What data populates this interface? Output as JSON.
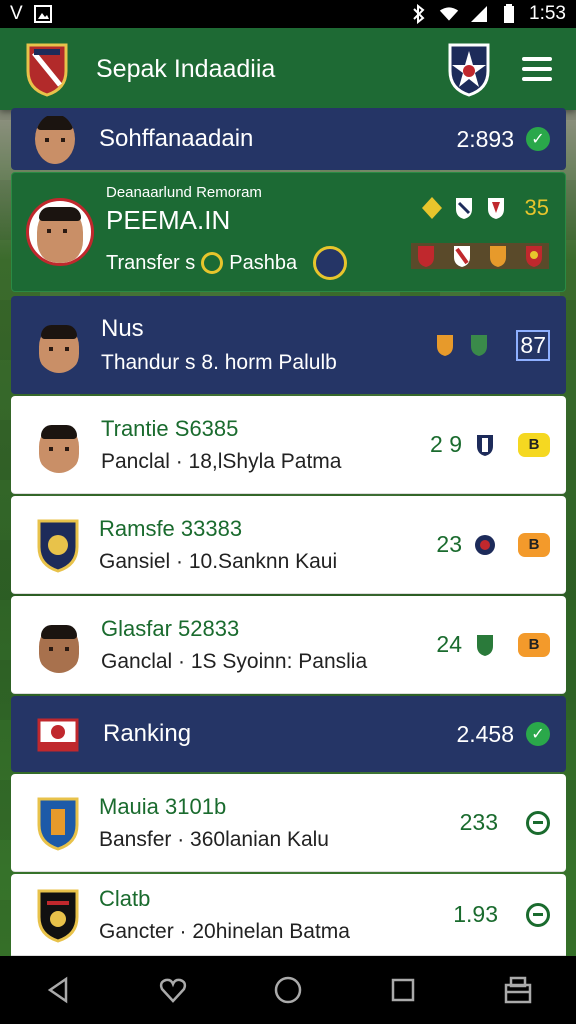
{
  "status": {
    "left_text": "V",
    "time": "1:53"
  },
  "appbar": {
    "title": "Sepak Indaadiia"
  },
  "rows": [
    {
      "title": "Sohffanaadain",
      "score": "2:893"
    },
    {
      "small": "Deanaarlund Remoram",
      "title": "PEEMA.IN",
      "sub_left": "Transfer  s",
      "sub_right": "Pashba",
      "score": "35"
    },
    {
      "title": "Nus",
      "sub": "Thandur s 8. horm Palulb",
      "score": "87"
    },
    {
      "title": "Trantie S6385",
      "sub": "Panclal · 18,lShyla Patma",
      "score": "2 9",
      "badge": "B"
    },
    {
      "title": "Ramsfe 33383",
      "sub": "Gansiel · 10.Sanknn Kaui",
      "score": "23",
      "badge": "B"
    },
    {
      "title": "Glasfar 52833",
      "sub": "Ganclal · 1S Syoinn: Panslia",
      "score": "24",
      "badge": "B"
    },
    {
      "title": "Ranking",
      "score": "2.458"
    },
    {
      "title": "Mauia 3101b",
      "sub": "Bansfer · 360lanian Kalu",
      "score": "233"
    },
    {
      "title": "Clatb",
      "sub": "Gancter · 20hinelan Batma",
      "score": "1.93"
    }
  ],
  "colors": {
    "appbar": "#1e6a34",
    "navy": "#253566",
    "green": "#1c6a34",
    "accent_green": "#2aa84a",
    "badge_yellow": "#f5d821",
    "badge_orange": "#f39a2b"
  }
}
